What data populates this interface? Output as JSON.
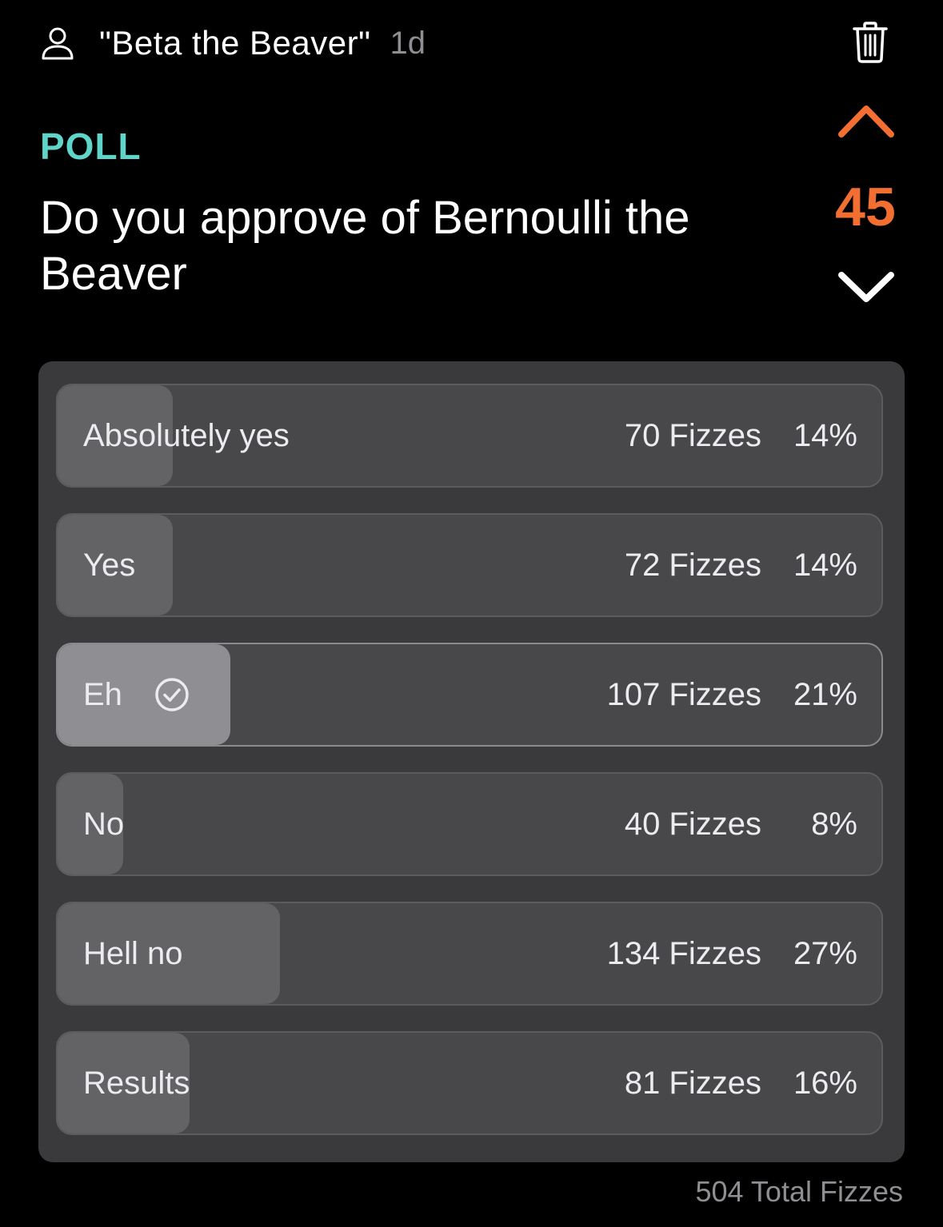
{
  "post": {
    "author": "\"Beta the Beaver\"",
    "age": "1d",
    "tag": "POLL",
    "question": "Do you approve of Bernoulli the Beaver",
    "score": "45"
  },
  "poll": {
    "options": [
      {
        "label": "Absolutely yes",
        "count": "70 Fizzes",
        "percent": "14%",
        "share": 0.14,
        "selected": false
      },
      {
        "label": "Yes",
        "count": "72 Fizzes",
        "percent": "14%",
        "share": 0.14,
        "selected": false
      },
      {
        "label": "Eh",
        "count": "107 Fizzes",
        "percent": "21%",
        "share": 0.21,
        "selected": true
      },
      {
        "label": "No",
        "count": "40 Fizzes",
        "percent": "8%",
        "share": 0.08,
        "selected": false
      },
      {
        "label": "Hell no",
        "count": "134 Fizzes",
        "percent": "27%",
        "share": 0.27,
        "selected": false
      },
      {
        "label": "Results",
        "count": "81 Fizzes",
        "percent": "16%",
        "share": 0.16,
        "selected": false
      }
    ],
    "total": "504 Total Fizzes"
  },
  "colors": {
    "accent_teal": "#5fd5c9",
    "vote_orange": "#f26f31",
    "background": "#000000"
  },
  "icons": {
    "user": "person-outline-icon",
    "trash": "trash-icon",
    "upvote": "chevron-up-icon",
    "downvote": "chevron-down-icon",
    "selected": "check-circle-icon"
  }
}
